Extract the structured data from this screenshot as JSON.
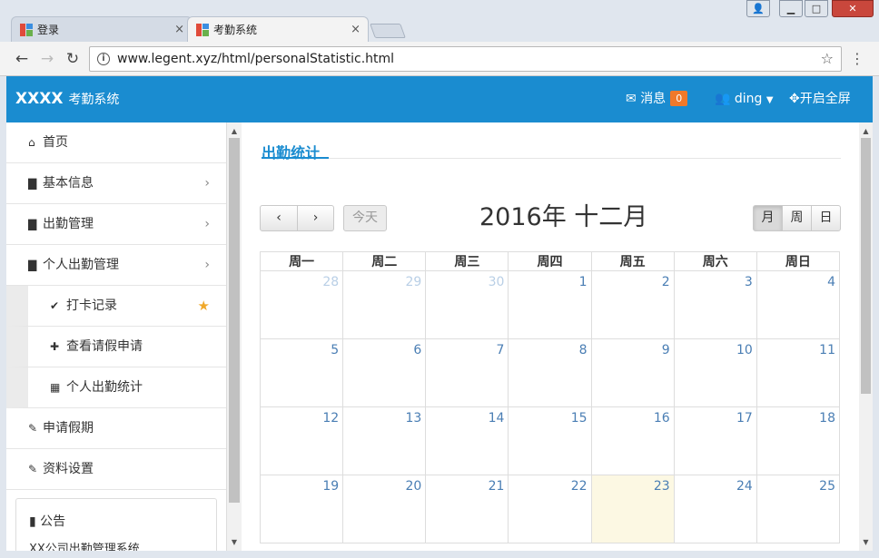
{
  "browser": {
    "tabs": [
      {
        "label": "登录",
        "close": "×"
      },
      {
        "label": "考勤系统",
        "close": "×"
      }
    ],
    "url": "www.legent.xyz/html/personalStatistic.html",
    "window_buttons": {
      "user": "👤",
      "minimize": "▁",
      "maximize": "□",
      "close": "✕"
    }
  },
  "topbar": {
    "brand": "XXXX",
    "system": "考勤系统",
    "messages_label": "消息",
    "messages_count": "0",
    "user": "ding",
    "fullscreen": "开启全屏",
    "accent": "#1a8cd0"
  },
  "sidebar": {
    "items": [
      {
        "label": "首页",
        "icon": "home-icon"
      },
      {
        "label": "基本信息",
        "icon": "file-icon"
      },
      {
        "label": "出勤管理",
        "icon": "file-icon"
      },
      {
        "label": "个人出勤管理",
        "icon": "file-icon"
      },
      {
        "label": "打卡记录",
        "icon": "check-icon"
      },
      {
        "label": "查看请假申请",
        "icon": "puzzle-icon"
      },
      {
        "label": "个人出勤统计",
        "icon": "grid-icon"
      },
      {
        "label": "申请假期",
        "icon": "edit-icon"
      },
      {
        "label": "资料设置",
        "icon": "edit-icon"
      }
    ],
    "notice": {
      "title": "公告",
      "content": "XX公司出勤管理系统"
    }
  },
  "main": {
    "page_title": "出勤统计",
    "calendar": {
      "prev": "‹",
      "next": "›",
      "today": "今天",
      "title": "2016年 十二月",
      "views": [
        "月",
        "周",
        "日"
      ],
      "weekdays": [
        "周一",
        "周二",
        "周三",
        "周四",
        "周五",
        "周六",
        "周日"
      ],
      "weeks": [
        [
          "28",
          "29",
          "30",
          "1",
          "2",
          "3",
          "4"
        ],
        [
          "5",
          "6",
          "7",
          "8",
          "9",
          "10",
          "11"
        ],
        [
          "12",
          "13",
          "14",
          "15",
          "16",
          "17",
          "18"
        ],
        [
          "19",
          "20",
          "21",
          "22",
          "23",
          "24",
          "25"
        ]
      ],
      "today_date": "23",
      "today_color": "#fcf8e3"
    }
  }
}
